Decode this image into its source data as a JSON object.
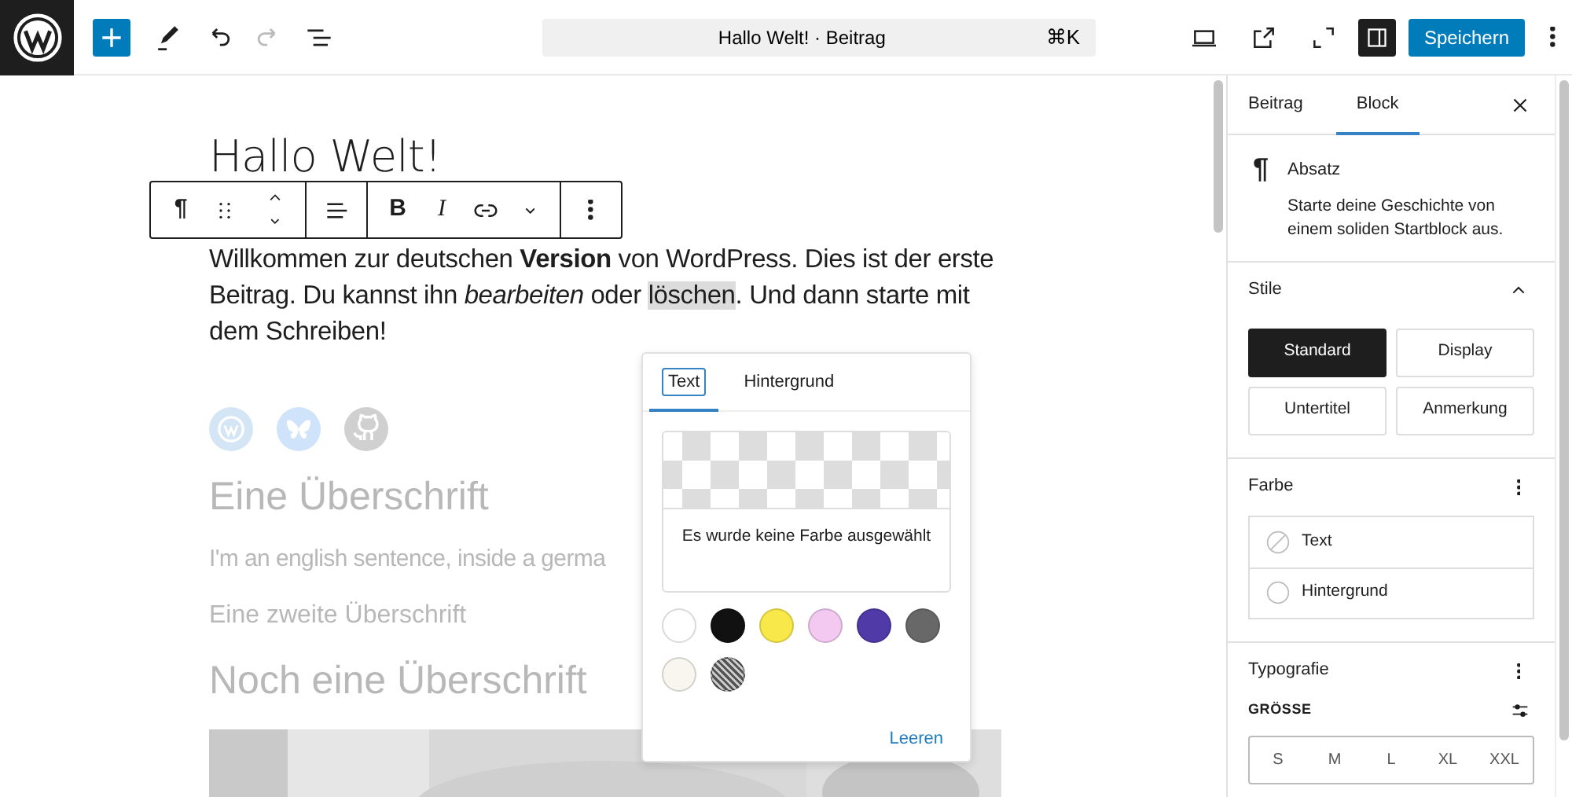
{
  "topbar": {
    "tools": [
      {
        "kind": "inserter",
        "disabled": false
      },
      {
        "kind": "tools",
        "disabled": false
      },
      {
        "kind": "undo",
        "disabled": false
      },
      {
        "kind": "redo",
        "disabled": true
      },
      {
        "kind": "list-view",
        "disabled": false
      }
    ],
    "command": {
      "title": "Hallo Welt! · Beitrag",
      "shortcut": "⌘K"
    },
    "actions": [
      {
        "kind": "preview",
        "pressed": false
      },
      {
        "kind": "view-post",
        "pressed": false
      },
      {
        "kind": "fullscreen",
        "pressed": false
      },
      {
        "kind": "settings",
        "pressed": true
      }
    ],
    "save": "Speichern"
  },
  "editor": {
    "title": "Hallo Welt!",
    "block_toolbar": [
      [
        {
          "kind": "glyph",
          "text": "¶"
        },
        {
          "kind": "drag"
        },
        {
          "kind": "movers"
        }
      ],
      [
        {
          "kind": "align"
        }
      ],
      [
        {
          "kind": "bold",
          "text": "B"
        },
        {
          "kind": "italic",
          "text": "I"
        },
        {
          "kind": "link"
        },
        {
          "kind": "more"
        }
      ],
      [
        {
          "kind": "options"
        }
      ]
    ],
    "paragraph": [
      {
        "text": "Willkommen zur deutschen **Version** von WordPress. Dies ist der erste Beitrag. Du kannst ihn *bearbeiten* oder ",
        "selected": false
      },
      {
        "text": "löschen",
        "selected": true
      },
      {
        "text": ". Und dann starte mit dem Schreiben!",
        "selected": false
      }
    ],
    "social_links": [
      {
        "kind": "wordpress",
        "color": "#d4e6f5"
      },
      {
        "kind": "bluesky",
        "color": "#cfe3fb"
      },
      {
        "kind": "github",
        "color": "#d0d0d0"
      }
    ],
    "faded_blocks": [
      {
        "kind": "heading",
        "text": "Eine Überschrift"
      },
      {
        "kind": "paragraph",
        "text": "I'm an english sentence, inside a germa"
      },
      {
        "kind": "subheading",
        "text": "Eine zweite Überschrift"
      },
      {
        "kind": "heading",
        "text": "Noch eine Überschrift"
      }
    ],
    "image": {
      "kind": "picture"
    }
  },
  "color_popover": {
    "tabs": [
      {
        "label": "Text",
        "selected": true
      },
      {
        "label": "Hintergrund",
        "selected": false
      }
    ],
    "preview_text": "Es wurde keine Farbe ausgewählt",
    "swatches": [
      {
        "kind": "solid",
        "color": "#ffffff"
      },
      {
        "kind": "solid",
        "color": "#111111"
      },
      {
        "kind": "solid",
        "color": "#f9e84a"
      },
      {
        "kind": "solid",
        "color": "#f3c9f1"
      },
      {
        "kind": "solid",
        "color": "#503aa8"
      },
      {
        "kind": "solid",
        "color": "#686868"
      },
      {
        "kind": "solid",
        "color": "#f8f6ef"
      },
      {
        "kind": "pattern"
      }
    ],
    "clear": "Leeren"
  },
  "sidebar": {
    "tabs": [
      {
        "label": "Beitrag",
        "selected": false
      },
      {
        "label": "Block",
        "selected": true
      }
    ],
    "block": {
      "icon": "¶",
      "name": "Absatz",
      "description": "Starte deine Geschichte von einem soliden Startblock aus."
    },
    "styles": {
      "title": "Stile",
      "expanded": true,
      "options": [
        {
          "label": "Standard",
          "selected": true
        },
        {
          "label": "Display",
          "selected": false
        },
        {
          "label": "Untertitel",
          "selected": false
        },
        {
          "label": "Anmerkung",
          "selected": false
        }
      ]
    },
    "color": {
      "title": "Farbe",
      "items": [
        {
          "label": "Text",
          "kind": "none"
        },
        {
          "label": "Hintergrund",
          "kind": "empty"
        }
      ]
    },
    "typography": {
      "title": "Typografie",
      "size_label": "GRÖSSE",
      "sizes": [
        {
          "label": "S",
          "selected": false
        },
        {
          "label": "M",
          "selected": false
        },
        {
          "label": "L",
          "selected": false
        },
        {
          "label": "XL",
          "selected": false
        },
        {
          "label": "XXL",
          "selected": false
        }
      ]
    }
  }
}
